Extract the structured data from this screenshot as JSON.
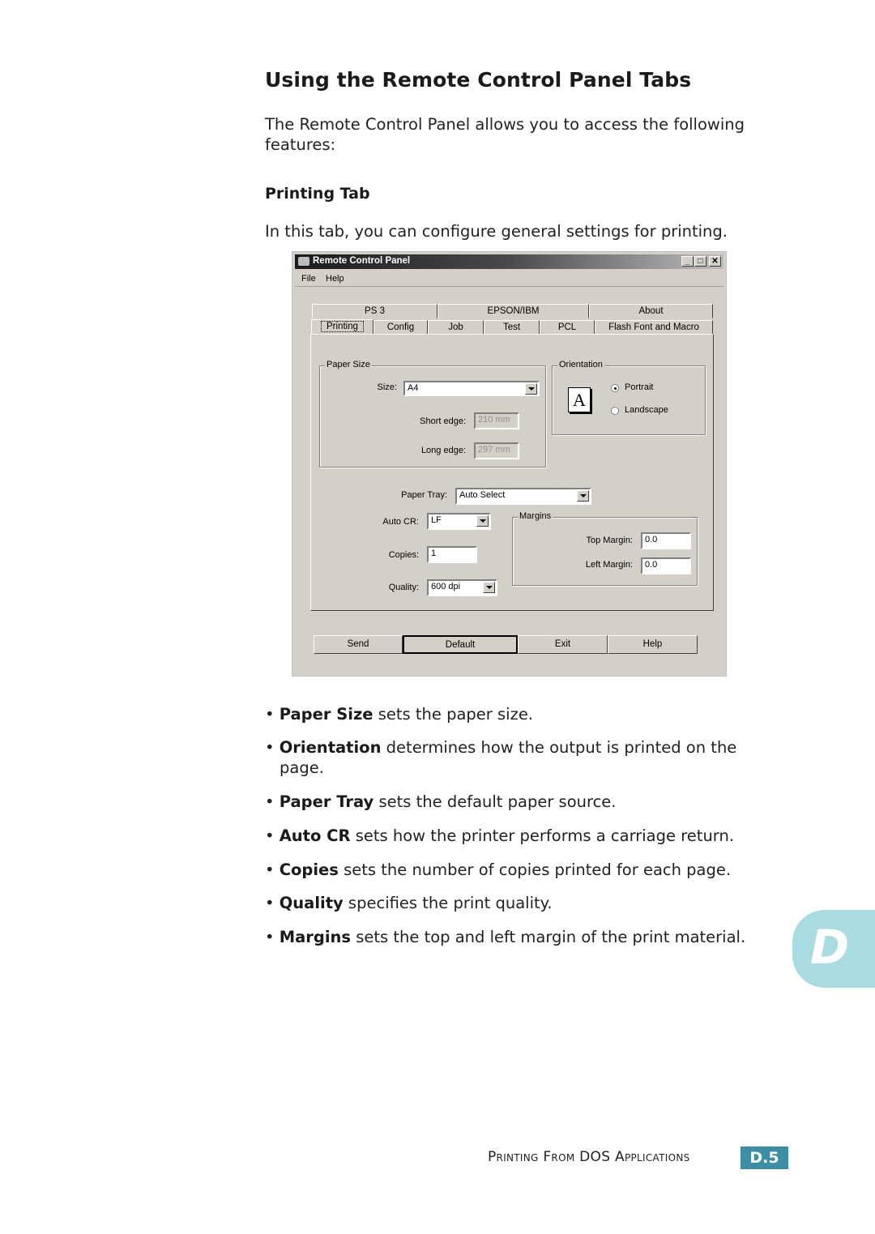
{
  "heading": "Using the Remote Control Panel Tabs",
  "intro": "The Remote Control Panel allows you to access the following features:",
  "intro_line1": "The Remote Control Panel allows you to access the following",
  "intro_line2": "features:",
  "section_title": "Printing Tab",
  "section_intro": "In this tab, you can configure general settings for printing.",
  "window": {
    "title": "Remote Control Panel",
    "controls": {
      "minimize": "_",
      "maximize": "□",
      "close": "✕"
    },
    "menu": [
      "File",
      "Help"
    ],
    "tabs_row1": [
      "PS 3",
      "EPSON/IBM",
      "About"
    ],
    "tabs_row2": [
      "Printing",
      "Config",
      "Job",
      "Test",
      "PCL",
      "Flash Font and Macro"
    ],
    "active_tab": "Printing",
    "paper_size": {
      "group_label": "Paper Size",
      "size_label": "Size:",
      "size_value": "A4",
      "short_edge_label": "Short edge:",
      "short_edge_value": "210 mm",
      "long_edge_label": "Long edge:",
      "long_edge_value": "297 mm"
    },
    "orientation": {
      "group_label": "Orientation",
      "icon_letter": "A",
      "options": [
        "Portrait",
        "Landscape"
      ],
      "selected": "Portrait"
    },
    "paper_tray": {
      "label": "Paper Tray:",
      "value": "Auto Select"
    },
    "auto_cr": {
      "label": "Auto CR:",
      "value": "LF"
    },
    "copies": {
      "label": "Copies:",
      "value": "1"
    },
    "quality": {
      "label": "Quality:",
      "value": "600 dpi"
    },
    "margins": {
      "group_label": "Margins",
      "top_label": "Top Margin:",
      "top_value": "0.0",
      "left_label": "Left Margin:",
      "left_value": "0.0"
    },
    "buttons": [
      "Send",
      "Default",
      "Exit",
      "Help"
    ],
    "default_button": "Default"
  },
  "bullets": [
    {
      "term": "Paper Size",
      "text": " sets the paper size."
    },
    {
      "term": "Orientation",
      "text": " determines how the output is printed on the",
      "cont": "page."
    },
    {
      "term": "Paper Tray",
      "text": " sets the default paper source."
    },
    {
      "term": "Auto CR",
      "text": " sets how the printer performs a carriage return."
    },
    {
      "term": "Copies",
      "text": " sets the number of copies printed for each page."
    },
    {
      "term": "Quality",
      "text": " specifies the print quality."
    },
    {
      "term": "Margins",
      "text": " sets the top and left margin of the print material."
    }
  ],
  "side_tab_letter": "D",
  "footer": {
    "chapter": "Printing From DOS Applications",
    "page": "D.5"
  },
  "colors": {
    "side_tab": "#a8dce0",
    "page_badge": "#3b8ea5",
    "dialog_bg": "#d4d0c8"
  }
}
